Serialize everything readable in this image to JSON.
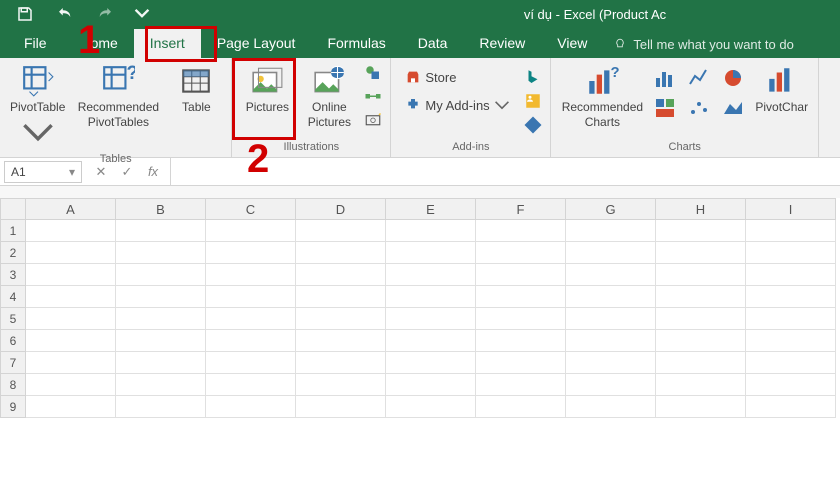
{
  "title": "ví dụ - Excel (Product Ac",
  "tabs": {
    "file": "File",
    "home": "ome",
    "insert": "Insert",
    "pagelayout": "Page Layout",
    "formulas": "Formulas",
    "data": "Data",
    "review": "Review",
    "view": "View"
  },
  "tellme": "Tell me what you want to do",
  "ribbon": {
    "tables": {
      "pivot": "PivotTable",
      "recpivot": "Recommended\nPivotTables",
      "table": "Table",
      "label": "Tables"
    },
    "ill": {
      "pictures": "Pictures",
      "online": "Online\nPictures",
      "label": "Illustrations"
    },
    "addins": {
      "store": "Store",
      "my": "My Add-ins",
      "label": "Add-ins"
    },
    "charts": {
      "rec": "Recommended\nCharts",
      "pivotchart": "PivotChar",
      "label": "Charts"
    }
  },
  "namebox": "A1",
  "columns": [
    "A",
    "B",
    "C",
    "D",
    "E",
    "F",
    "G",
    "H",
    "I"
  ],
  "rows": [
    "1",
    "2",
    "3",
    "4",
    "5",
    "6",
    "7",
    "8",
    "9"
  ],
  "annot": {
    "n1": "1",
    "n2": "2"
  }
}
